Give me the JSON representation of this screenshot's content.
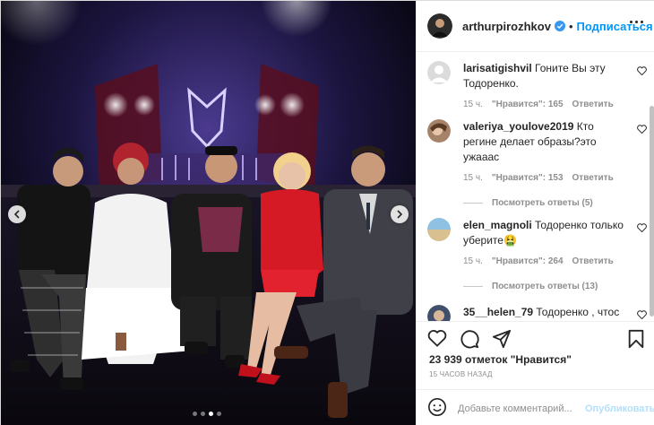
{
  "header": {
    "username": "arthurpirozhkov",
    "separator": "•",
    "follow_label": "Подписаться",
    "verified_icon": "verified-badge-icon",
    "more_icon": "more-options-icon"
  },
  "comments": [
    {
      "username": "larisatigishvil",
      "text": "Гоните Вы эту Тодоренко.",
      "time": "15 ч.",
      "likes": "\"Нравится\": 165",
      "reply_label": "Ответить",
      "avatar": "default-avatar"
    },
    {
      "username": "valeriya_youlove2019",
      "text": "Кто регине делает образы?это ужааас",
      "time": "15 ч.",
      "likes": "\"Нравится\": 153",
      "reply_label": "Ответить",
      "replies": "Посмотреть ответы (5)",
      "avatar": "photo-avatar"
    },
    {
      "username": "elen_magnoli",
      "text": "Тодоренко только уберите🤮",
      "time": "15 ч.",
      "likes": "\"Нравится\": 264",
      "reply_label": "Ответить",
      "replies": "Посмотреть ответы (13)",
      "avatar": "photo-avatar"
    },
    {
      "username": "35__helen_79",
      "text": "Тодоренко , чтоc",
      "avatar": "photo-avatar"
    }
  ],
  "actions": {
    "like_icon": "heart-icon",
    "comment_icon": "comment-icon",
    "share_icon": "share-icon",
    "save_icon": "bookmark-icon",
    "likes_text": "23 939 отметок \"Нравится\"",
    "time_text": "15 ЧАСОВ НАЗАД"
  },
  "add_comment": {
    "placeholder": "Добавьте комментарий...",
    "publish_label": "Опубликовать",
    "emoji_icon": "emoji-smile-icon"
  },
  "carousel": {
    "prev_icon": "chevron-left-icon",
    "next_icon": "chevron-right-icon",
    "dot_count": 4,
    "active_dot": 3
  },
  "colors": {
    "accent": "#0095f6",
    "publish_disabled": "#b2dffc",
    "meta_gray": "#8e8e8e"
  }
}
